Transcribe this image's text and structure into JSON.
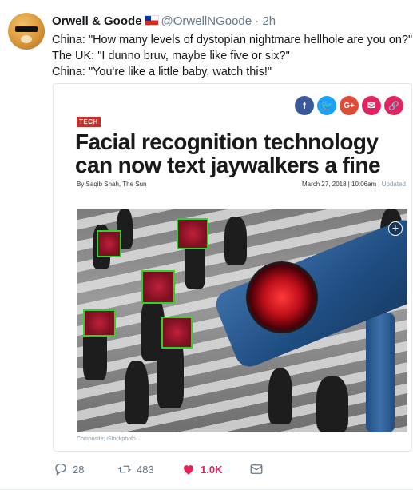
{
  "tweet": {
    "name": "Orwell & Goode",
    "handle": "@OrwellNGoode",
    "separator": "·",
    "time": "2h",
    "lines": [
      "China: \"How many levels of dystopian nightmare hellhole are you on?\"",
      "The UK: \"I dunno bruv, maybe like five or six?\"",
      "China: \"You're like a little baby, watch this!\""
    ]
  },
  "article": {
    "tag": "TECH",
    "headline": "Facial recognition technology can now text jaywalkers a fine",
    "byline": "By Saqib Shah, The Sun",
    "date": "March 27, 2018",
    "time": "10:06am",
    "updated": "Updated",
    "credit": "Composite; iStockphoto",
    "share_icons": [
      {
        "name": "facebook-icon",
        "glyph": "f",
        "color": "#3b5998"
      },
      {
        "name": "twitter-icon",
        "glyph": "🐦",
        "color": "#1da1f2"
      },
      {
        "name": "google-plus-icon",
        "glyph": "G+",
        "color": "#dd4b39"
      },
      {
        "name": "email-icon",
        "glyph": "✉",
        "color": "#e0245e"
      },
      {
        "name": "link-icon",
        "glyph": "🔗",
        "color": "#e0245e"
      }
    ]
  },
  "actions": {
    "replies": "28",
    "retweets": "483",
    "likes": "1.0K"
  }
}
